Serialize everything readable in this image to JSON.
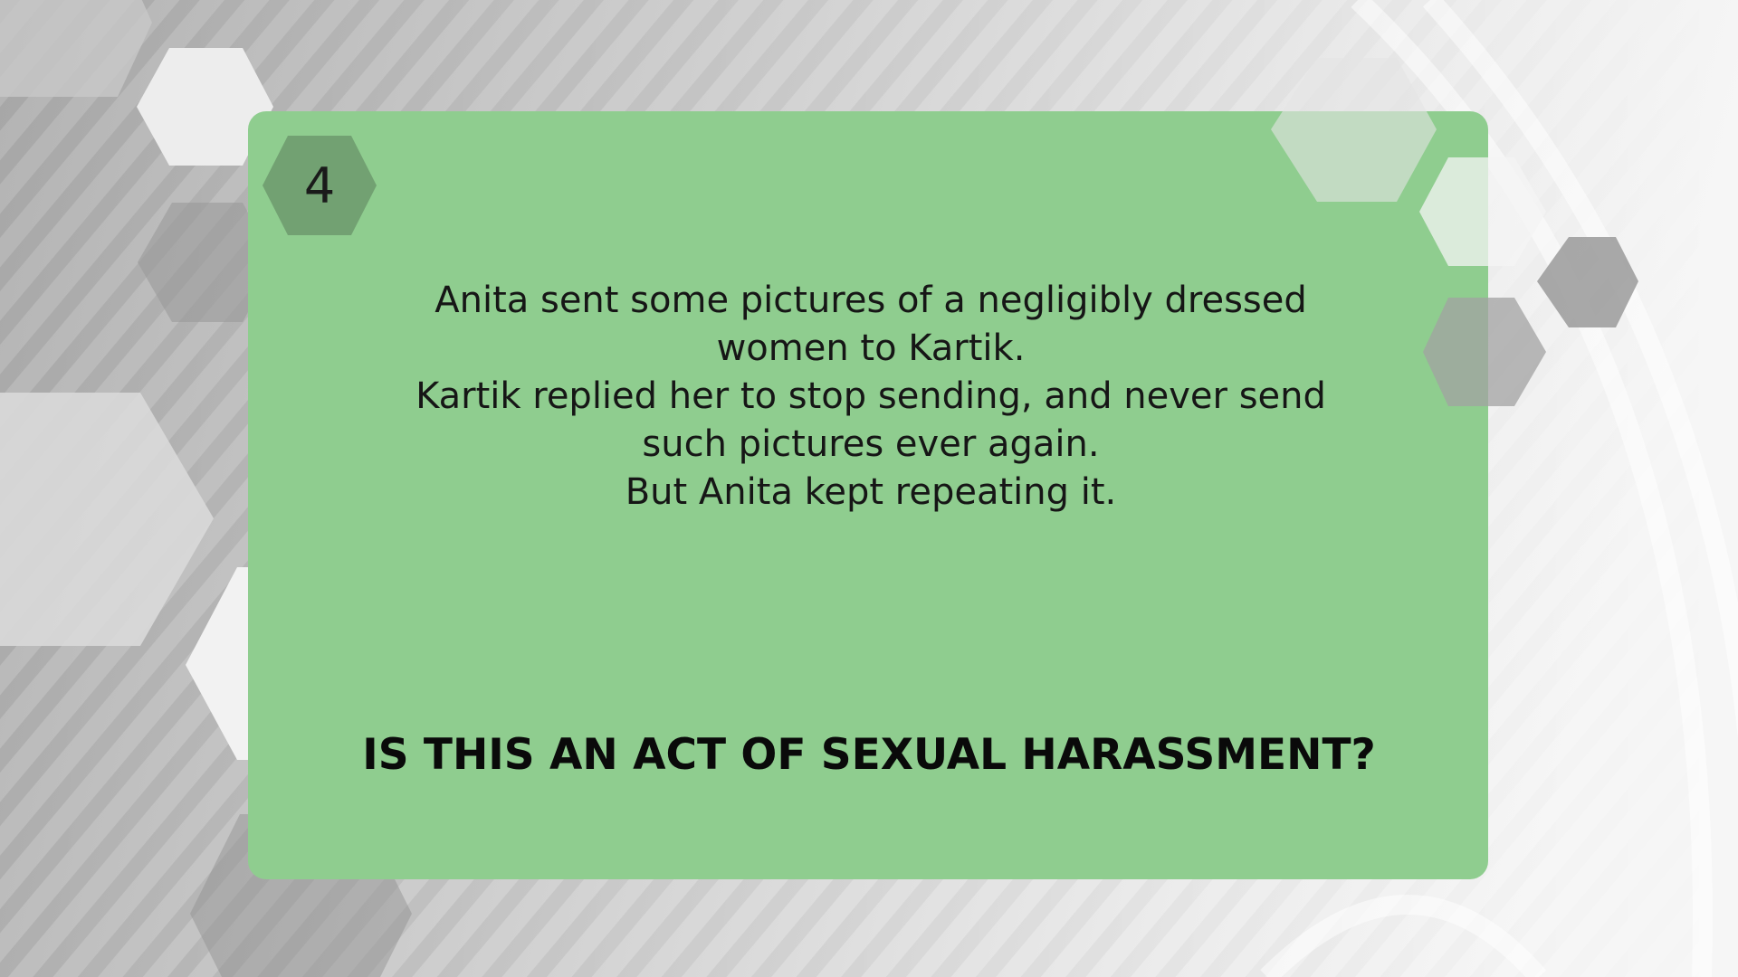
{
  "colors": {
    "card": "#8fcd8f",
    "background": "#dcdcdc",
    "text": "#161616"
  },
  "slide": {
    "number": "4",
    "scenario_lines": [
      "Anita sent some pictures of a negligibly dressed",
      "women to Kartik.",
      "Kartik replied her to stop sending, and never send",
      "such pictures ever again.",
      "But Anita kept repeating it."
    ],
    "question": "IS THIS AN ACT OF SEXUAL HARASSMENT?"
  }
}
